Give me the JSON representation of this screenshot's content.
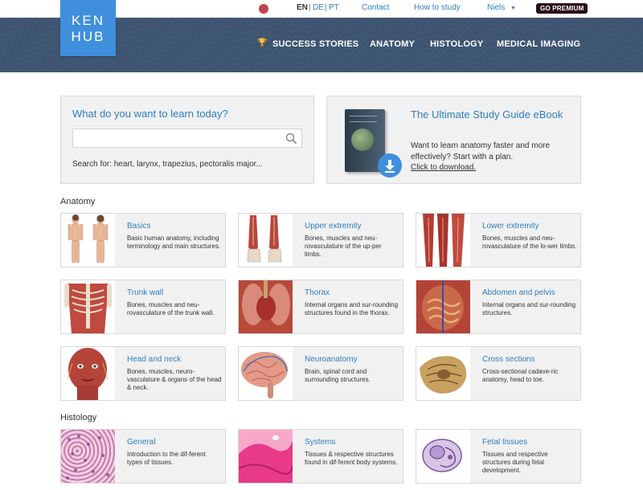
{
  "topbar": {
    "notification_count": "4",
    "languages": [
      "EN",
      "DE",
      "PT"
    ],
    "language_separators": [
      "|",
      "|"
    ],
    "contact": "Contact",
    "how_to_study": "How to study",
    "user_name": "Niels",
    "go_premium": "GO PREMIUM"
  },
  "header": {
    "logo_line1": "KEN",
    "logo_line2": "HUB",
    "nav": [
      "SUCCESS STORIES",
      "ANATOMY",
      "HISTOLOGY",
      "MEDICAL IMAGING"
    ],
    "trophy_glyph": "🏆"
  },
  "search": {
    "title": "What do you want to learn today?",
    "value": "",
    "placeholder": "",
    "hint": "Search for: heart, larynx, trapezius, pectoralis major..."
  },
  "ebook": {
    "title": "The Ultimate Study Guide eBook",
    "text": "Want to learn anatomy faster and more effectively? Start with a plan.",
    "link": "Click to download."
  },
  "sections": {
    "anatomy": "Anatomy",
    "histology": "Histology"
  },
  "cards": [
    {
      "title": "Basics",
      "desc": "Basic human anatomy, including terminology and main structures."
    },
    {
      "title": "Upper extremity",
      "desc": "Bones, muscles and neu-rovasculature of the up-per limbs."
    },
    {
      "title": "Lower extremity",
      "desc": "Bones, muscles and neu-rovasculature of the lo-wer limbs."
    },
    {
      "title": "Trunk wall",
      "desc": "Bones, muscles and neu-rovasculature of the trunk wall."
    },
    {
      "title": "Thorax",
      "desc": "Internal organs and sur-rounding structures found in the thorax."
    },
    {
      "title": "Abdomen and pelvis",
      "desc": "Internal organs and sur-rounding structures."
    },
    {
      "title": "Head and neck",
      "desc": "Bones, muscles, neuro-vasculature & organs of the head & neck."
    },
    {
      "title": "Neuroanatomy",
      "desc": "Brain, spinal cord and surrounding structures."
    },
    {
      "title": "Cross sections",
      "desc": "Cross-sectional cadave-ric anatomy, head to toe."
    },
    {
      "title": "General",
      "desc": "Introduction to the dif-ferent types of tissues."
    },
    {
      "title": "Systems",
      "desc": "Tissues & respective structures found in dif-ferent body systems."
    },
    {
      "title": "Fetal tissues",
      "desc": "Tissues and respective structures during fetal development."
    }
  ],
  "colors": {
    "accent": "#2f7ec0",
    "logo": "#3f8fdc",
    "header": "#3d5470",
    "badge": "#d83a3a",
    "premium": "#2a0f16"
  }
}
